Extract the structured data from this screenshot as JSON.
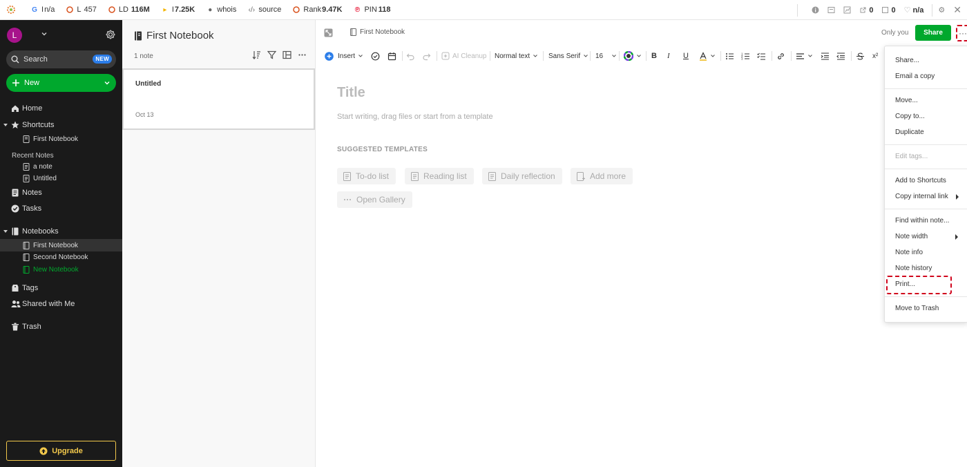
{
  "seo_toolbar": {
    "items": [
      {
        "icon": "google-icon",
        "prefix": "I",
        "value": "n/a",
        "color": "#4285f4"
      },
      {
        "icon": "circle-icon",
        "prefix": "L",
        "value": "457",
        "color": "#d9531e"
      },
      {
        "icon": "circle-icon",
        "prefix": "LD",
        "value": "116M",
        "color": "#d9531e"
      },
      {
        "icon": "bing-icon",
        "prefix": "I",
        "value": "7.25K",
        "color": "#f4b400"
      },
      {
        "icon": "person-icon",
        "prefix": "",
        "value": "whois",
        "color": "#666666"
      },
      {
        "icon": "code-icon",
        "prefix": "",
        "value": "source",
        "color": "#666666"
      },
      {
        "icon": "circle-icon",
        "prefix": "Rank",
        "value": "9.47K",
        "color": "#d9531e"
      },
      {
        "icon": "pinterest-icon",
        "prefix": "PIN",
        "value": "118",
        "color": "#e60023"
      }
    ],
    "right": {
      "links_a": "0",
      "links_b": "0",
      "heart": "n/a"
    }
  },
  "sidebar": {
    "avatar_letter": "L",
    "search_label": "Search",
    "search_badge": "NEW",
    "new_label": "New",
    "home": "Home",
    "shortcuts": "Shortcuts",
    "shortcut_items": [
      "First Notebook"
    ],
    "recent_heading": "Recent Notes",
    "recent_items": [
      "a note",
      "Untitled"
    ],
    "notes": "Notes",
    "tasks": "Tasks",
    "notebooks": "Notebooks",
    "notebook_items": [
      "First Notebook",
      "Second Notebook",
      "New Notebook"
    ],
    "tags": "Tags",
    "shared": "Shared with Me",
    "trash": "Trash",
    "upgrade": "Upgrade"
  },
  "notes_list": {
    "title": "First Notebook",
    "count": "1 note",
    "notes": [
      {
        "title": "Untitled",
        "date": "Oct 13"
      }
    ]
  },
  "editor": {
    "breadcrumb": "First Notebook",
    "visibility": "Only you",
    "share": "Share",
    "more": "···",
    "toolbar": {
      "insert": "Insert",
      "ai_cleanup": "AI Cleanup",
      "text_style": "Normal text",
      "font": "Sans Serif",
      "size": "16",
      "superscript": "x²"
    },
    "title_placeholder": "Title",
    "body_placeholder": "Start writing, drag files or start from a template",
    "suggested_heading": "SUGGESTED TEMPLATES",
    "templates": [
      "To-do list",
      "Reading list",
      "Daily reflection",
      "Add more",
      "Open Gallery"
    ]
  },
  "more_menu": {
    "items": [
      "Share...",
      "Email a copy",
      "Move...",
      "Copy to...",
      "Duplicate",
      "Edit tags...",
      "Add to Shortcuts",
      "Copy internal link",
      "Find within note...",
      "Note width",
      "Note info",
      "Note history",
      "Print...",
      "Move to Trash"
    ]
  },
  "colors": {
    "accent_green": "#00a82d",
    "highlight_red": "#d0021b",
    "upgrade_gold": "#f2c84b",
    "sidebar_bg": "#1a1a1a"
  }
}
